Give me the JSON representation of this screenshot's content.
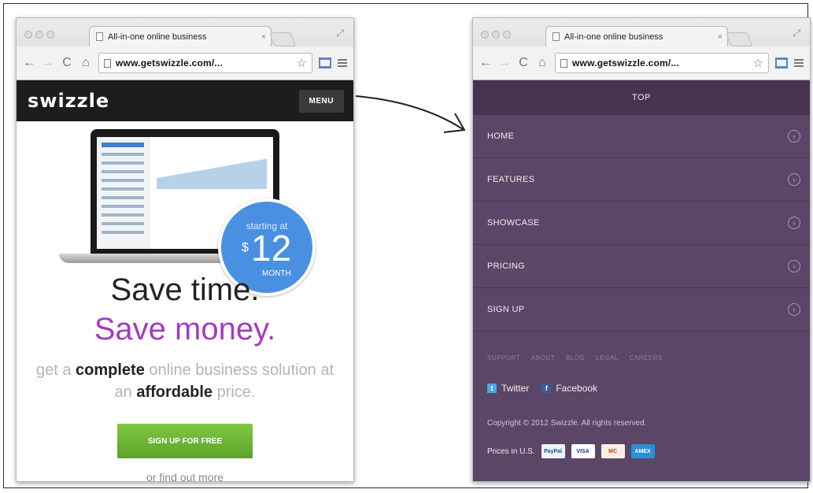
{
  "browser": {
    "tab_title": "All-in-one online business",
    "tab_close": "×",
    "url": "www.getswizzle.com/..."
  },
  "left_page": {
    "logo": "swizzle",
    "menu_button": "MENU",
    "price_badge": {
      "prefix": "starting at",
      "currency": "$",
      "amount": "12",
      "period": "MONTH"
    },
    "headline_1": "Save time.",
    "headline_2": "Save money.",
    "tagline_parts": [
      "get a ",
      "complete",
      " online business solution at an ",
      "affordable",
      " price."
    ],
    "cta": "SIGN UP FOR FREE",
    "find_out_more": "or find out more"
  },
  "right_page": {
    "top_label": "TOP",
    "menu_items": [
      "HOME",
      "FEATURES",
      "SHOWCASE",
      "PRICING",
      "SIGN UP"
    ],
    "footer_links": [
      "SUPPORT",
      "ABOUT",
      "BLOG",
      "LEGAL",
      "CAREERS"
    ],
    "social": [
      {
        "label": "Twitter",
        "icon": "twitter-icon"
      },
      {
        "label": "Facebook",
        "icon": "facebook-icon"
      }
    ],
    "copyright": "Copyright © 2012 Swizzle. All rights reserved.",
    "prices_label": "Prices in U.S.",
    "payment_cards": [
      "PayPal",
      "VISA",
      "MC",
      "AMEX"
    ]
  },
  "colors": {
    "menu_bg": "#5b4667",
    "menu_top_bg": "#46344f",
    "accent_purple": "#a33cc0",
    "price_badge_blue": "#4a90e2",
    "cta_green": "#6fb535"
  }
}
